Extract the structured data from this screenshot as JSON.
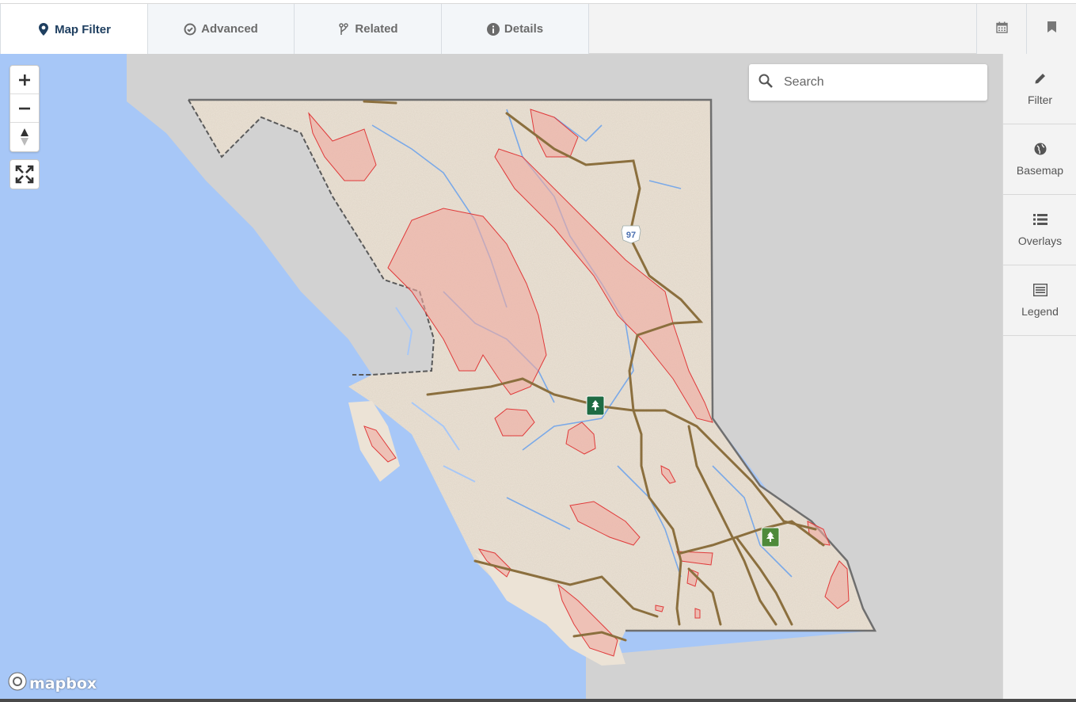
{
  "tabs": [
    {
      "label": "Map Filter",
      "icon": "map-marker-icon",
      "active": true
    },
    {
      "label": "Advanced",
      "icon": "check-circle-icon",
      "active": false
    },
    {
      "label": "Related",
      "icon": "branch-icon",
      "active": false
    },
    {
      "label": "Details",
      "icon": "info-circle-icon",
      "active": false
    }
  ],
  "toolbar_icons": [
    "calendar-icon",
    "bookmark-icon"
  ],
  "map": {
    "search_placeholder": "Search",
    "attribution": "mapbox",
    "highway_shield": "97",
    "controls": [
      "zoom-in",
      "zoom-out",
      "compass",
      "fullscreen"
    ],
    "colors": {
      "ocean": "#a7c7f7",
      "land": "#ece3d6",
      "neighbor_land": "#d2d2d2",
      "highlight_fill": "#f0aaa0",
      "highlight_stroke": "#e03a3a",
      "road": "#8b6f3e",
      "river": "#7aa9e8",
      "park_marker": "#2e7d4f"
    }
  },
  "sidebar": {
    "items": [
      {
        "label": "Filter",
        "icon": "pencil-icon"
      },
      {
        "label": "Basemap",
        "icon": "globe-icon"
      },
      {
        "label": "Overlays",
        "icon": "list-icon"
      },
      {
        "label": "Legend",
        "icon": "legend-icon"
      }
    ]
  }
}
